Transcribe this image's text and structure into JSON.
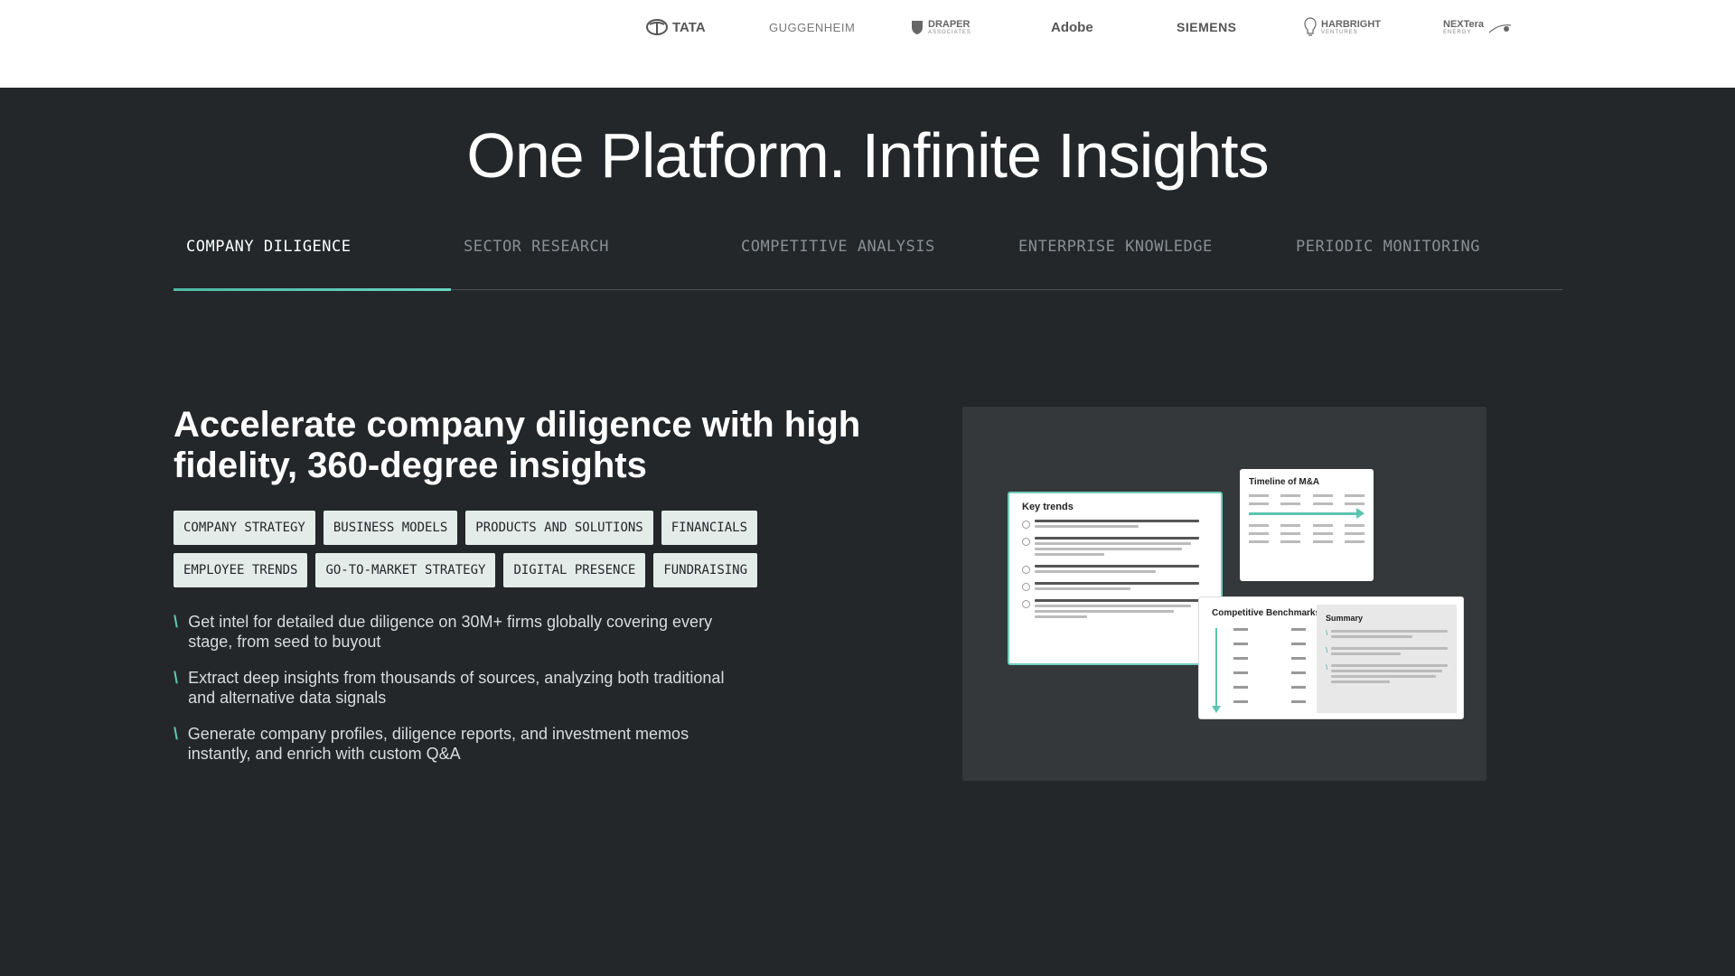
{
  "logos": {
    "tata": "TATA",
    "guggenheim": "GUGGENHEIM",
    "draper": "DRAPER",
    "draper_sub": "ASSOCIATES",
    "adobe": "Adobe",
    "siemens": "SIEMENS",
    "harbright": "HARBRIGHT",
    "harbright_sub": "VENTURES",
    "nextera": "NEXTera",
    "nextera_sub": "ENERGY"
  },
  "hero": {
    "title": "One Platform. Infinite Insights"
  },
  "tabs": [
    {
      "label": "COMPANY DILIGENCE",
      "active": true
    },
    {
      "label": "SECTOR RESEARCH",
      "active": false
    },
    {
      "label": "COMPETITIVE ANALYSIS",
      "active": false
    },
    {
      "label": "ENTERPRISE KNOWLEDGE",
      "active": false
    },
    {
      "label": "PERIODIC MONITORING",
      "active": false
    }
  ],
  "content": {
    "heading": "Accelerate company diligence with high fidelity, 360-degree insights",
    "tags": [
      "COMPANY STRATEGY",
      "BUSINESS MODELS",
      "PRODUCTS AND SOLUTIONS",
      "FINANCIALS",
      "EMPLOYEE TRENDS",
      "GO-TO-MARKET STRATEGY",
      "DIGITAL PRESENCE",
      "FUNDRAISING"
    ],
    "bullets": [
      "Get intel for detailed due diligence on 30M+ firms globally covering every stage, from seed to buyout",
      "Extract deep insights from thousands of sources, analyzing both traditional and alternative data signals",
      "Generate company profiles, diligence reports, and investment memos instantly, and enrich with custom Q&A"
    ]
  },
  "preview": {
    "key_trends": "Key trends",
    "timeline": "Timeline of M&A",
    "benchmarks": "Competitive Benchmarks",
    "summary": "Summary"
  },
  "colors": {
    "accent": "#5cc4b0",
    "background": "#23272a",
    "tag_bg": "#e3ece8"
  }
}
